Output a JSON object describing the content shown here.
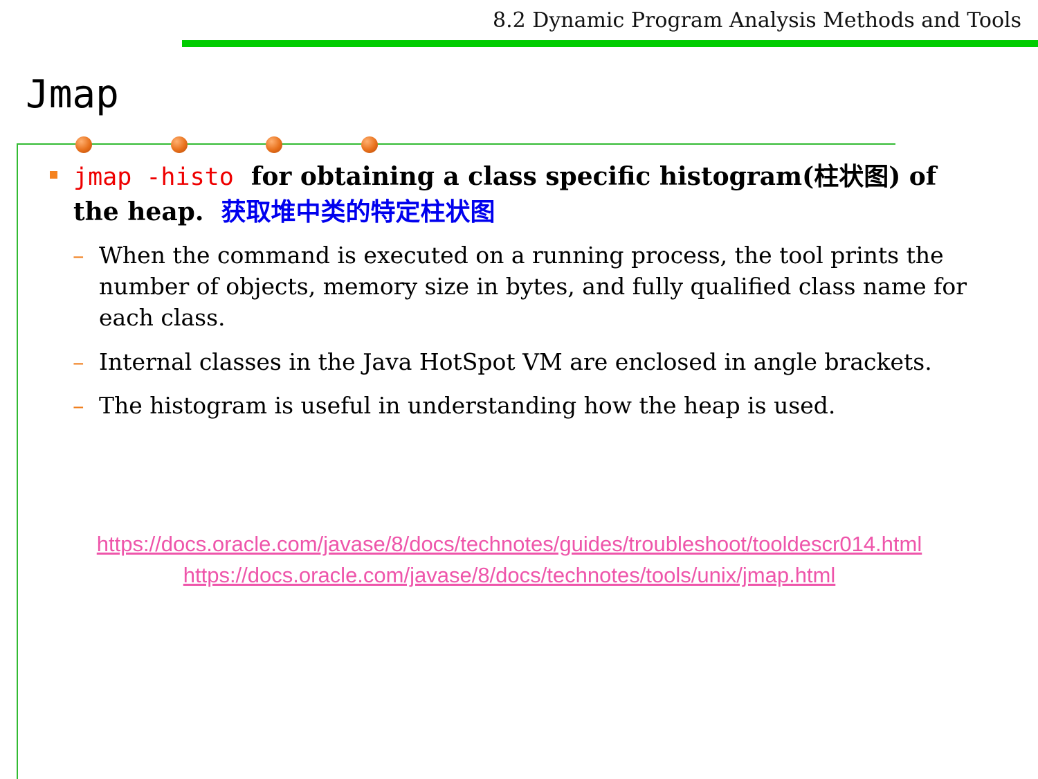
{
  "header": {
    "section_title": "8.2 Dynamic Program Analysis Methods and Tools"
  },
  "slide": {
    "title": "Jmap"
  },
  "main_point": {
    "command": "jmap -histo",
    "text_before_cn": "for obtaining a class specific histogram(",
    "cn_term": "柱状图",
    "text_after_cn": ") of the heap.",
    "cn_translation": "获取堆中类的特定柱状图"
  },
  "sub_points": [
    "When the command is executed on a running process, the tool prints the number of objects, memory size in bytes, and fully qualified class name for each class.",
    "Internal classes in the Java HotSpot VM are enclosed in angle brackets.",
    "The histogram is useful in understanding how the heap is used."
  ],
  "sub_marker": "–",
  "links": [
    "https://docs.oracle.com/javase/8/docs/technotes/guides/troubleshoot/tooldescr014.html",
    "https://docs.oracle.com/javase/8/docs/technotes/tools/unix/jmap.html"
  ],
  "colors": {
    "accent_green": "#00cc00",
    "frame_green": "#33bb33",
    "bullet_orange": "#f5821f",
    "dot_orange": "#e8711c",
    "command_red": "#ee0000",
    "chinese_blue": "#0000ee",
    "link_pink": "#ee55aa",
    "dash_orange": "#f08020"
  }
}
